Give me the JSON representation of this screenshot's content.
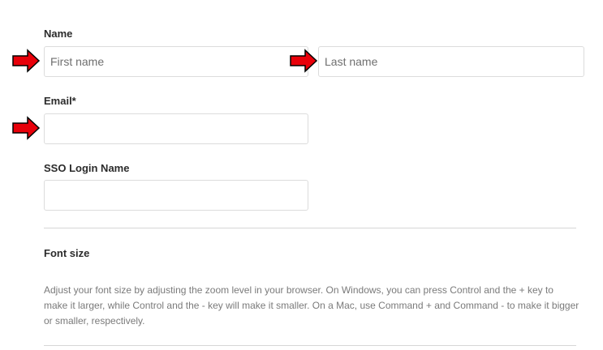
{
  "name_section": {
    "label": "Name",
    "first_name": {
      "placeholder": "First name",
      "value": ""
    },
    "last_name": {
      "placeholder": "Last name",
      "value": ""
    }
  },
  "email_section": {
    "label": "Email*",
    "value": ""
  },
  "sso_section": {
    "label": "SSO Login Name",
    "value": ""
  },
  "font_size_section": {
    "heading": "Font size",
    "description": "Adjust your font size by adjusting the zoom level in your browser. On Windows, you can press Control and the + key to make it larger, while Control and the - key will make it smaller. On a Mac, use Command + and Command - to make it bigger or smaller, respectively."
  },
  "annotation": {
    "arrow_color": "#e8000a",
    "arrow_icon": "red-arrow-right-icon"
  }
}
